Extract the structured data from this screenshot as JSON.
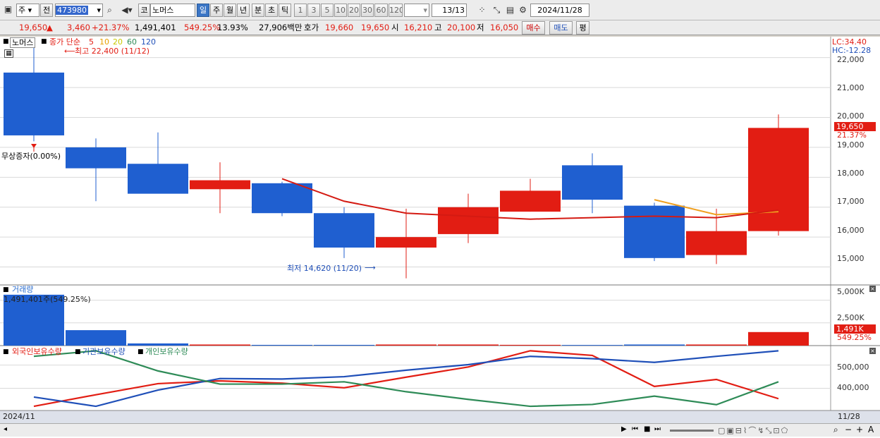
{
  "toolbar": {
    "period_main": "주",
    "period_prev": "전",
    "stock_code": "473980",
    "stock_name": "노머스",
    "market_badge": "코",
    "tabs": [
      "일",
      "주",
      "월",
      "년",
      "분",
      "초",
      "틱"
    ],
    "ranges": [
      "1",
      "3",
      "5",
      "10",
      "20",
      "30",
      "60",
      "120"
    ],
    "page_count": "13/13",
    "date": "2024/11/28"
  },
  "quote": {
    "price": "19,650",
    "arrow": "▲",
    "change": "3,460",
    "change_pct": "+21.37%",
    "volume": "1,491,401",
    "volume_ratio": "549.25%",
    "turnover": "13.93%",
    "amount": "27,906백만",
    "ask_label": "호가",
    "ask_price": "19,660",
    "bid_price": "19,650",
    "open_label": "시",
    "open": "16,210",
    "high_label": "고",
    "high": "20,100",
    "low_label": "저",
    "low": "16,050",
    "buy": "매수",
    "sell": "매도",
    "eval": "평"
  },
  "price_panel": {
    "stock_label": "노머스",
    "ma_label": "종가 단순",
    "ma_periods": [
      "5",
      "10",
      "20",
      "60",
      "120"
    ],
    "ma_colors": [
      "#e21d13",
      "#e8a000",
      "#c9c900",
      "#2e8b57",
      "#1f4fb8"
    ],
    "max_label": "최고 22,400 (11/12)",
    "min_label": "최저 14,620 (11/20)",
    "event_label": "무상증자(0.00%)",
    "lc": "LC:34.40",
    "hc": "HC:-12.28",
    "current_price": "19,650",
    "current_pct": "21.37%",
    "yticks": [
      "22,000",
      "21,000",
      "20,000",
      "19,000",
      "18,000",
      "17,000",
      "16,000",
      "15,000"
    ]
  },
  "volume_panel": {
    "title": "거래량",
    "value_label": "1,491,401주(549.25%)",
    "yticks": [
      "5,000K",
      "2,500K"
    ],
    "current": "1,491K",
    "current_pct": "549.25%"
  },
  "holding_panel": {
    "labels": [
      "외국인보유수량",
      "기관보유수량",
      "개인보유수량"
    ],
    "colors": [
      "#e21d13",
      "#1f4fb8",
      "#2e8b57"
    ],
    "yticks": [
      "500,000",
      "400,000"
    ]
  },
  "footer": {
    "start": "2024/11",
    "end": "11/28"
  },
  "chart_data": [
    {
      "type": "candlestick",
      "title": "노머스",
      "ylim": [
        14400,
        22700
      ],
      "candles": [
        {
          "o": 19400,
          "h": 22400,
          "l": 19200,
          "c": 21500,
          "color": "blue"
        },
        {
          "o": 19000,
          "h": 19300,
          "l": 17200,
          "c": 18300,
          "color": "blue"
        },
        {
          "o": 18450,
          "h": 19500,
          "l": 17600,
          "c": 17450,
          "color": "blue"
        },
        {
          "o": 17600,
          "h": 18500,
          "l": 16800,
          "c": 17900,
          "color": "red"
        },
        {
          "o": 17800,
          "h": 17850,
          "l": 16700,
          "c": 16800,
          "color": "blue"
        },
        {
          "o": 16800,
          "h": 17000,
          "l": 15300,
          "c": 15650,
          "color": "blue"
        },
        {
          "o": 15650,
          "h": 16950,
          "l": 14620,
          "c": 16000,
          "color": "red"
        },
        {
          "o": 16100,
          "h": 17450,
          "l": 15800,
          "c": 17000,
          "color": "red"
        },
        {
          "o": 16850,
          "h": 17950,
          "l": 16850,
          "c": 17550,
          "color": "red"
        },
        {
          "o": 18400,
          "h": 18800,
          "l": 16800,
          "c": 17250,
          "color": "blue"
        },
        {
          "o": 17050,
          "h": 17150,
          "l": 15200,
          "c": 15300,
          "color": "blue"
        },
        {
          "o": 15400,
          "h": 16950,
          "l": 15100,
          "c": 16200,
          "color": "red"
        },
        {
          "o": 16200,
          "h": 20100,
          "l": 16050,
          "c": 19650,
          "color": "red"
        }
      ],
      "ma5": [
        null,
        null,
        null,
        null,
        17950,
        17200,
        16800,
        16700,
        16600,
        16650,
        16700,
        16650,
        16900
      ],
      "ma10": [
        null,
        null,
        null,
        null,
        null,
        null,
        null,
        null,
        null,
        null,
        17250,
        16750,
        16850
      ]
    },
    {
      "type": "bar",
      "title": "거래량",
      "ylim": [
        0,
        5900
      ],
      "values": [
        5600,
        1700,
        240,
        120,
        80,
        80,
        120,
        120,
        85,
        70,
        120,
        120,
        1491
      ],
      "colors": [
        "blue",
        "blue",
        "blue",
        "red",
        "blue",
        "blue",
        "red",
        "red",
        "red",
        "blue",
        "blue",
        "red",
        "red"
      ]
    },
    {
      "type": "line",
      "ylim": [
        310000,
        560000
      ],
      "series": [
        {
          "name": "외국인보유수량",
          "color": "#e21d13",
          "values": [
            322000,
            372000,
            420000,
            432000,
            422000,
            402000,
            448000,
            492000,
            562000,
            542000,
            408000,
            438000,
            355000
          ]
        },
        {
          "name": "기관보유수량",
          "color": "#1f4fb8",
          "values": [
            362000,
            322000,
            392000,
            442000,
            440000,
            450000,
            478000,
            502000,
            538000,
            528000,
            512000,
            538000,
            562000
          ]
        },
        {
          "name": "개인보유수량",
          "color": "#2e8b57",
          "values": [
            538000,
            562000,
            475000,
            418000,
            418000,
            428000,
            385000,
            352000,
            322000,
            330000,
            366000,
            329000,
            428000
          ]
        }
      ]
    }
  ]
}
